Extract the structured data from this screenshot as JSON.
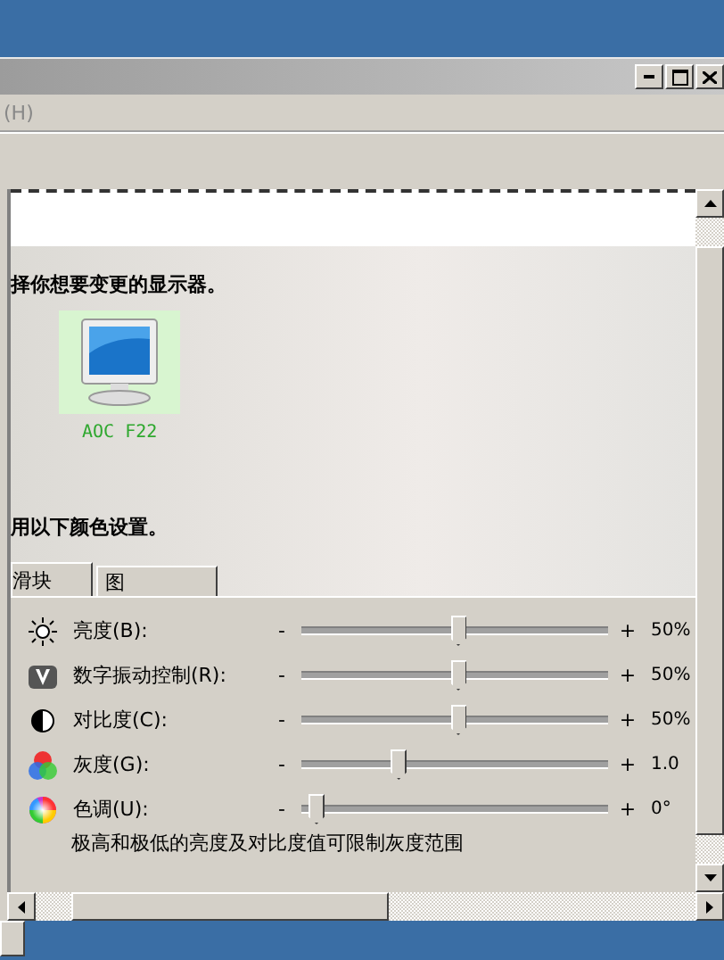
{
  "menu": [
    {
      "label": "(H)"
    }
  ],
  "heading_monitor": "择你想要变更的显示器。",
  "monitors": [
    {
      "label": "AOC F22",
      "selected": true
    }
  ],
  "heading_color": "用以下颜色设置。",
  "tabs": [
    {
      "label": "滑块",
      "selected": true
    },
    {
      "label": "图",
      "selected": false
    }
  ],
  "sliders": [
    {
      "kind": "brightness",
      "label": "亮度(B):",
      "minus": "-",
      "plus": "+",
      "level": 0.5,
      "reading": "50%"
    },
    {
      "kind": "vibrance",
      "label": "数字振动控制(R):",
      "minus": "-",
      "plus": "+",
      "level": 0.5,
      "reading": "50%"
    },
    {
      "kind": "contrast",
      "label": "对比度(C):",
      "minus": "-",
      "plus": "+",
      "level": 0.5,
      "reading": "50%"
    },
    {
      "kind": "gamma",
      "label": "灰度(G):",
      "minus": "-",
      "plus": "+",
      "level": 0.29,
      "reading": "1.0"
    },
    {
      "kind": "hue",
      "label": "色调(U):",
      "minus": "-",
      "plus": "+",
      "level": 0,
      "reading": "0°"
    }
  ],
  "note": "极高和极低的亮度及对比度值可限制灰度范围"
}
